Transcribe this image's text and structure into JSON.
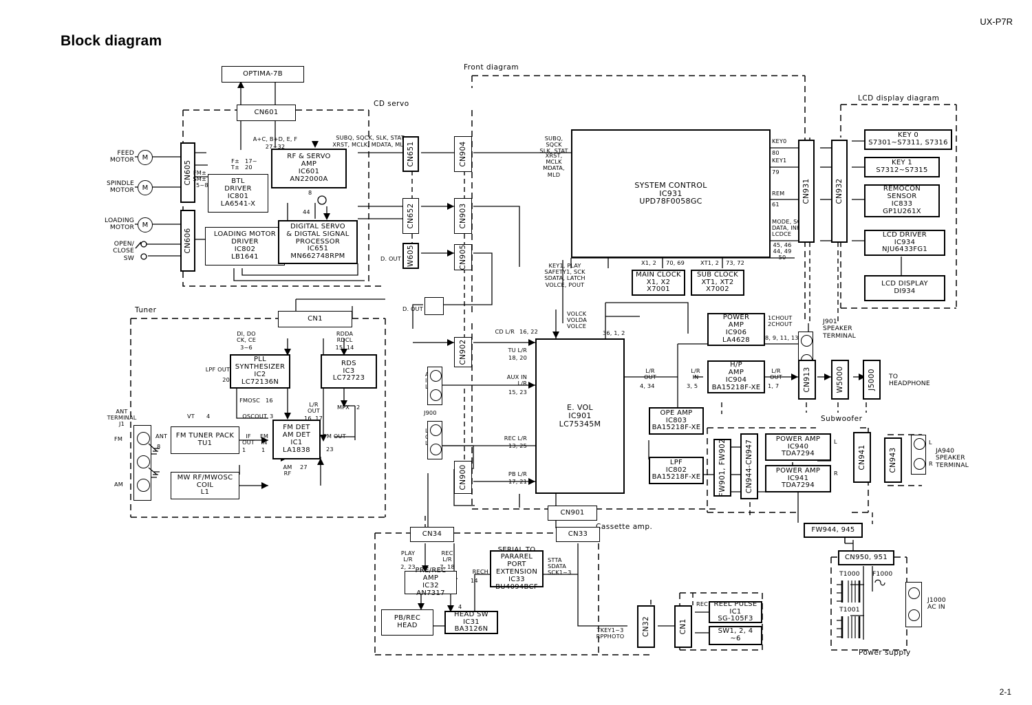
{
  "page": {
    "title": "Block diagram",
    "model": "UX-P7R",
    "page_number": "2-1"
  },
  "sections": [
    {
      "name": "cd-servo",
      "label": "CD servo"
    },
    {
      "name": "front-diagram",
      "label": "Front diagram"
    },
    {
      "name": "lcd-display-diagram",
      "label": "LCD display diagram"
    },
    {
      "name": "tuner",
      "label": "Tuner"
    },
    {
      "name": "cassette-amp",
      "label": "Cassette amp."
    },
    {
      "name": "subwoofer",
      "label": "Subwoofer"
    },
    {
      "name": "power-supply",
      "label": "Power supply"
    }
  ],
  "blocks": {
    "optima": "OPTIMA-7B",
    "cn601": "CN601",
    "rf_servo_amp": "RF & SERVO\nAMP\nIC601\nAN22000A",
    "btl_driver": "BTL\nDRIVER\nIC801\nLA6541-X",
    "loading_motor_driver": "LOADING MOTOR\nDRIVER\nIC802\nLB1641",
    "digital_servo": "DIGITAL SERVO\n& DIGTAL SIGNAL\nPROCESSOR\nIC651\nMN662748RPM",
    "system_control": "SYSTEM CONTROL\nIC931\nUPD78F0058GC",
    "main_clock": "MAIN CLOCK\nX1, X2\nX7001",
    "sub_clock": "SUB CLOCK\nXT1, XT2\nX7002",
    "key0": "KEY 0\nS7301~S7311, S7316",
    "key1": "KEY 1\nS7312~S7315",
    "remocon_sensor": "REMOCON\nSENSOR\nIC833\nGP1U261X",
    "lcd_driver": "LCD DRIVER\nIC934\nNJU6433FG1",
    "lcd_display": "LCD DISPLAY\nDI934",
    "pll_synth": "PLL\nSYNTHESIZER\nIC2\nLC72136N",
    "rds": "RDS\nIC3\nLC72723",
    "fm_tuner_pack": "FM TUNER PACK\nTU1",
    "fm_am_det": "FM DET\nAM DET\nIC1\nLA1838",
    "mw_coil": "MW RF/MWOSC\nCOIL\nL1",
    "evol": "E. VOL\nIC901\nLC75345M",
    "power_amp_906": "POWER\nAMP\nIC906\nLA4628",
    "hp_amp": "H/P\nAMP\nIC904\nBA15218F-XE",
    "ope_amp": "OPE AMP\nIC803\nBA15218F-XE",
    "lpf": "LPF\nIC802\nBA15218F-XE",
    "power_amp_940": "POWER AMP\nIC940\nTDA7294",
    "power_amp_941": "POWER AMP\nIC941\nTDA7294",
    "pre_rec_amp": "PRE/REC AMP\nIC32\nAN7317",
    "serial_to_parallel": "SERIAL TO\nPARAREL\nPORT\nEXTENSION\nIC33\nBU4094BCF",
    "head_sw": "HEAD SW\nIC31\nBA3126N",
    "pb_rec_head": "PB/REC HEAD",
    "reel_pulse": "REEL PULSE\nIC1\nSG-105F3",
    "sw_block": "SW1, 2, 4\n~6",
    "fw944": "FW944, 945",
    "cn950_951": "CN950, 951",
    "cn901": "CN901",
    "cn34": "CN34",
    "cn33": "CN33",
    "cn1_tuner": "CN1"
  },
  "connectors": [
    "CN605",
    "CN606",
    "CN651",
    "CN652",
    "W605",
    "CN904",
    "CN903",
    "CN905",
    "CN902",
    "CN900",
    "CN931",
    "CN932",
    "CN913",
    "W5000",
    "J5000",
    "FW901, FW902",
    "CN944-CN947",
    "CN941",
    "CN943",
    "CN32",
    "CN1"
  ],
  "terminals": {
    "feed_motor": "FEED\nMOTOR",
    "spindle_motor": "SPINDLE\nMOTOR",
    "loading_motor": "LOADING\nMOTOR",
    "open_close_sw": "OPEN/\nCLOSE\nSW",
    "motor_symbol": "M",
    "ant_terminal": "ANT\nTERMINAL\nJ1",
    "ant_fm": "FM",
    "ant_am": "AM",
    "j900": "J900",
    "aux_in": "AUX\nIN\nL/R",
    "line_out": "LINE\nOUT\nL/R",
    "j901_speaker": "J901\nSPEAKER\nTERMINAL",
    "to_headphone": "TO\nHEADPHONE",
    "ja940_speaker": "JA940\nSPEAKER\nTERMINAL",
    "j1000_ac_in": "J1000\nAC IN",
    "ch_l": "L",
    "ch_r": "R",
    "t1000": "T1000",
    "t1001": "T1001",
    "f1000": "F1000"
  },
  "signals": {
    "cd_abcdef": "A+C, B+D, E, F",
    "cd_pins_27_32": "27~32",
    "f_t": "F±\nT±",
    "pins_17_20": "17~\n20",
    "fm_sm": "FM±\nSM±",
    "pins_5_8": "5~8",
    "pin8": "8",
    "pin44": "44",
    "subq_line1": "SUBQ, SQCK, SLK, STAT",
    "subq_line2": "XRST, MCLK, MDATA, MLD",
    "subq_sc1": "SUBQ, SQCK\nSLK, STAT",
    "subq_sc2": "XRST, MCLK\nMDATA, MLD",
    "d_out": "D. OUT",
    "d_out2": "D. OUT",
    "key0_pin": "KEY0",
    "key0_num": "80",
    "key1_pin": "KEY1",
    "key1_num": "79",
    "rem_pin": "REM",
    "rem_num": "61",
    "mode_scl": "MODE, SCL\nDATA, INH\nLCDCE",
    "mode_nums": "45, 46\n44, 49\n50",
    "x12": "X1, 2",
    "x12_num": "70, 69",
    "xt12": "XT1, 2",
    "xt12_num": "73, 72",
    "key1_play": "KEY1, PLAY\nSAFETY1, SCK\nSDATA, LATCH\nVOLCE, POUT",
    "cd_lr": "CD L/R",
    "cd_lr_num": "16, 22",
    "volck": "VOLCK\nVOLDA\nVOLCE",
    "volck_num": "36, 1, 2",
    "tu_lr": "TU L/R",
    "tu_lr_num": "18, 20",
    "aux_in_lr": "AUX IN\nL/R",
    "aux_in_num": "15, 23",
    "rec_lr": "REC L/R",
    "rec_lr_num": "13, 25",
    "pb_lr": "PB L/R",
    "pb_lr_num": "17, 21",
    "lr_out": "L/R\nOUT",
    "lr_out_num": "4, 34",
    "lr_in": "L/R\nIN",
    "lr_in_num": "3, 5",
    "lr_out2": "L/R\nOUT",
    "lr_out2_num": "1, 7",
    "ch_out": "1CHOUT\n2CHOUT",
    "ch_out_num": "8, 9, 11, 13",
    "di_do": "DI, DO\nCK, CE",
    "di_do_num": "3~6",
    "rdda": "RDDA\nRDCL",
    "rdda_num": "15, 14",
    "lpf_out": "LPF OUT",
    "lpf_out_num": "20",
    "fmosc": "FMOSC",
    "fmosc_num": "16",
    "oscout": "OSCOUT",
    "oscout_num": "3",
    "vt": "VT",
    "vt_num": "4",
    "ant": "ANT",
    "ant_num": "8",
    "if_out": "IF\nOUT",
    "if_out_num": "1",
    "fm_in": "FM\nIN",
    "fm_in_num": "1",
    "fm_out": "FM OUT",
    "fm_out_num": "23",
    "am_rf": "AM\nRF",
    "am_rf_num": "27",
    "lr_out_tuner": "L/R\nOUT",
    "lr_out_tuner_num": "16, 17",
    "mpx": "MPX",
    "mpx_num": "2",
    "play_lr": "PLAY\nL/R",
    "play_lr_num": "2, 23",
    "rec_lr_cass": "REC\nL/R",
    "rec_lr_cass_num": "7, 18",
    "rech": "RECH",
    "rech_num": "14",
    "head_sw_num": "4",
    "stta": "STTA\nSDATA\nSCK1~3",
    "tkey": "TKEY1~3\nRPPHOTO",
    "rec": "REC"
  },
  "colors": {
    "ink": "#000000",
    "paper": "#ffffff"
  }
}
